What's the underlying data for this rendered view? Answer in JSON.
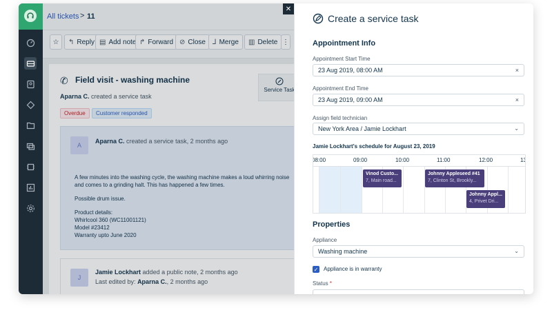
{
  "breadcrumb": {
    "link": "All tickets",
    "separator": ">",
    "ticket_number": "11"
  },
  "toolbar": {
    "star": "☆",
    "reply": "Reply",
    "add_note": "Add note",
    "forward": "Forward",
    "close": "Close",
    "merge": "Merge",
    "delete": "Delete",
    "more": "⋮"
  },
  "ticket": {
    "title": "Field visit - washing machine",
    "creator": "Aparna C.",
    "action": "created a service task",
    "badges": [
      "Overdue",
      "Customer responded"
    ],
    "service_tab_label": "Service Task",
    "message": {
      "avatar": "A",
      "author": "Aparna C.",
      "header_rest": "created a service task, 2 months ago",
      "paragraphs": [
        "A few minutes into the washing cycle, the washing machine makes a loud whirring noise and comes to a grinding halt. This has happened a few times.",
        "Possible drum issue.",
        "Product details:"
      ],
      "product_lines": [
        "Whirlcool 360 (WC11001121)",
        "Model #23412",
        "Warranty upto June 2020"
      ]
    },
    "note": {
      "avatar": "J",
      "author": "Jamie Lockhart",
      "header_rest": "added a public note, 2 months ago",
      "edited_prefix": "Last edited by:",
      "editor": "Aparna C.",
      "edited_rest": ", 2 months ago"
    }
  },
  "panel": {
    "close": "✕",
    "title": "Create a service task",
    "appointment_section": "Appointment Info",
    "start_label": "Appointment Start Time",
    "start_value": "23 Aug 2019, 08:00 AM",
    "end_label": "Appointment End Time",
    "end_value": "23 Aug 2019, 09:00 AM",
    "technician_label": "Assign field technician",
    "technician_value": "New York Area / Jamie Lockhart",
    "schedule_title": "Jamie Lockhart's schedule for August 23, 2019",
    "schedule_times": [
      "08:00",
      "09:00",
      "10:00",
      "11:00",
      "12:00",
      "13"
    ],
    "events": [
      {
        "name": "Vinod Custo...",
        "address": "7, Main road..."
      },
      {
        "name": "Johnny Appleseed #41",
        "address": "7, Clinton St, Brookly..."
      },
      {
        "name": "Johnny Appl...",
        "address": "4, Privet Dri..."
      }
    ],
    "properties_section": "Properties",
    "appliance_label": "Appliance",
    "appliance_value": "Washing machine",
    "warranty_checkbox": "Appliance is in warranty",
    "warranty_checked": true,
    "status_label": "Status",
    "required_mark": "*",
    "clear_symbol": "×",
    "chevron_symbol": "⌄"
  },
  "colors": {
    "accent": "#2c5cc5",
    "nav_bg": "#1d2b36",
    "brand_green": "#2fa56f",
    "event_bg": "#4a3f7a"
  }
}
